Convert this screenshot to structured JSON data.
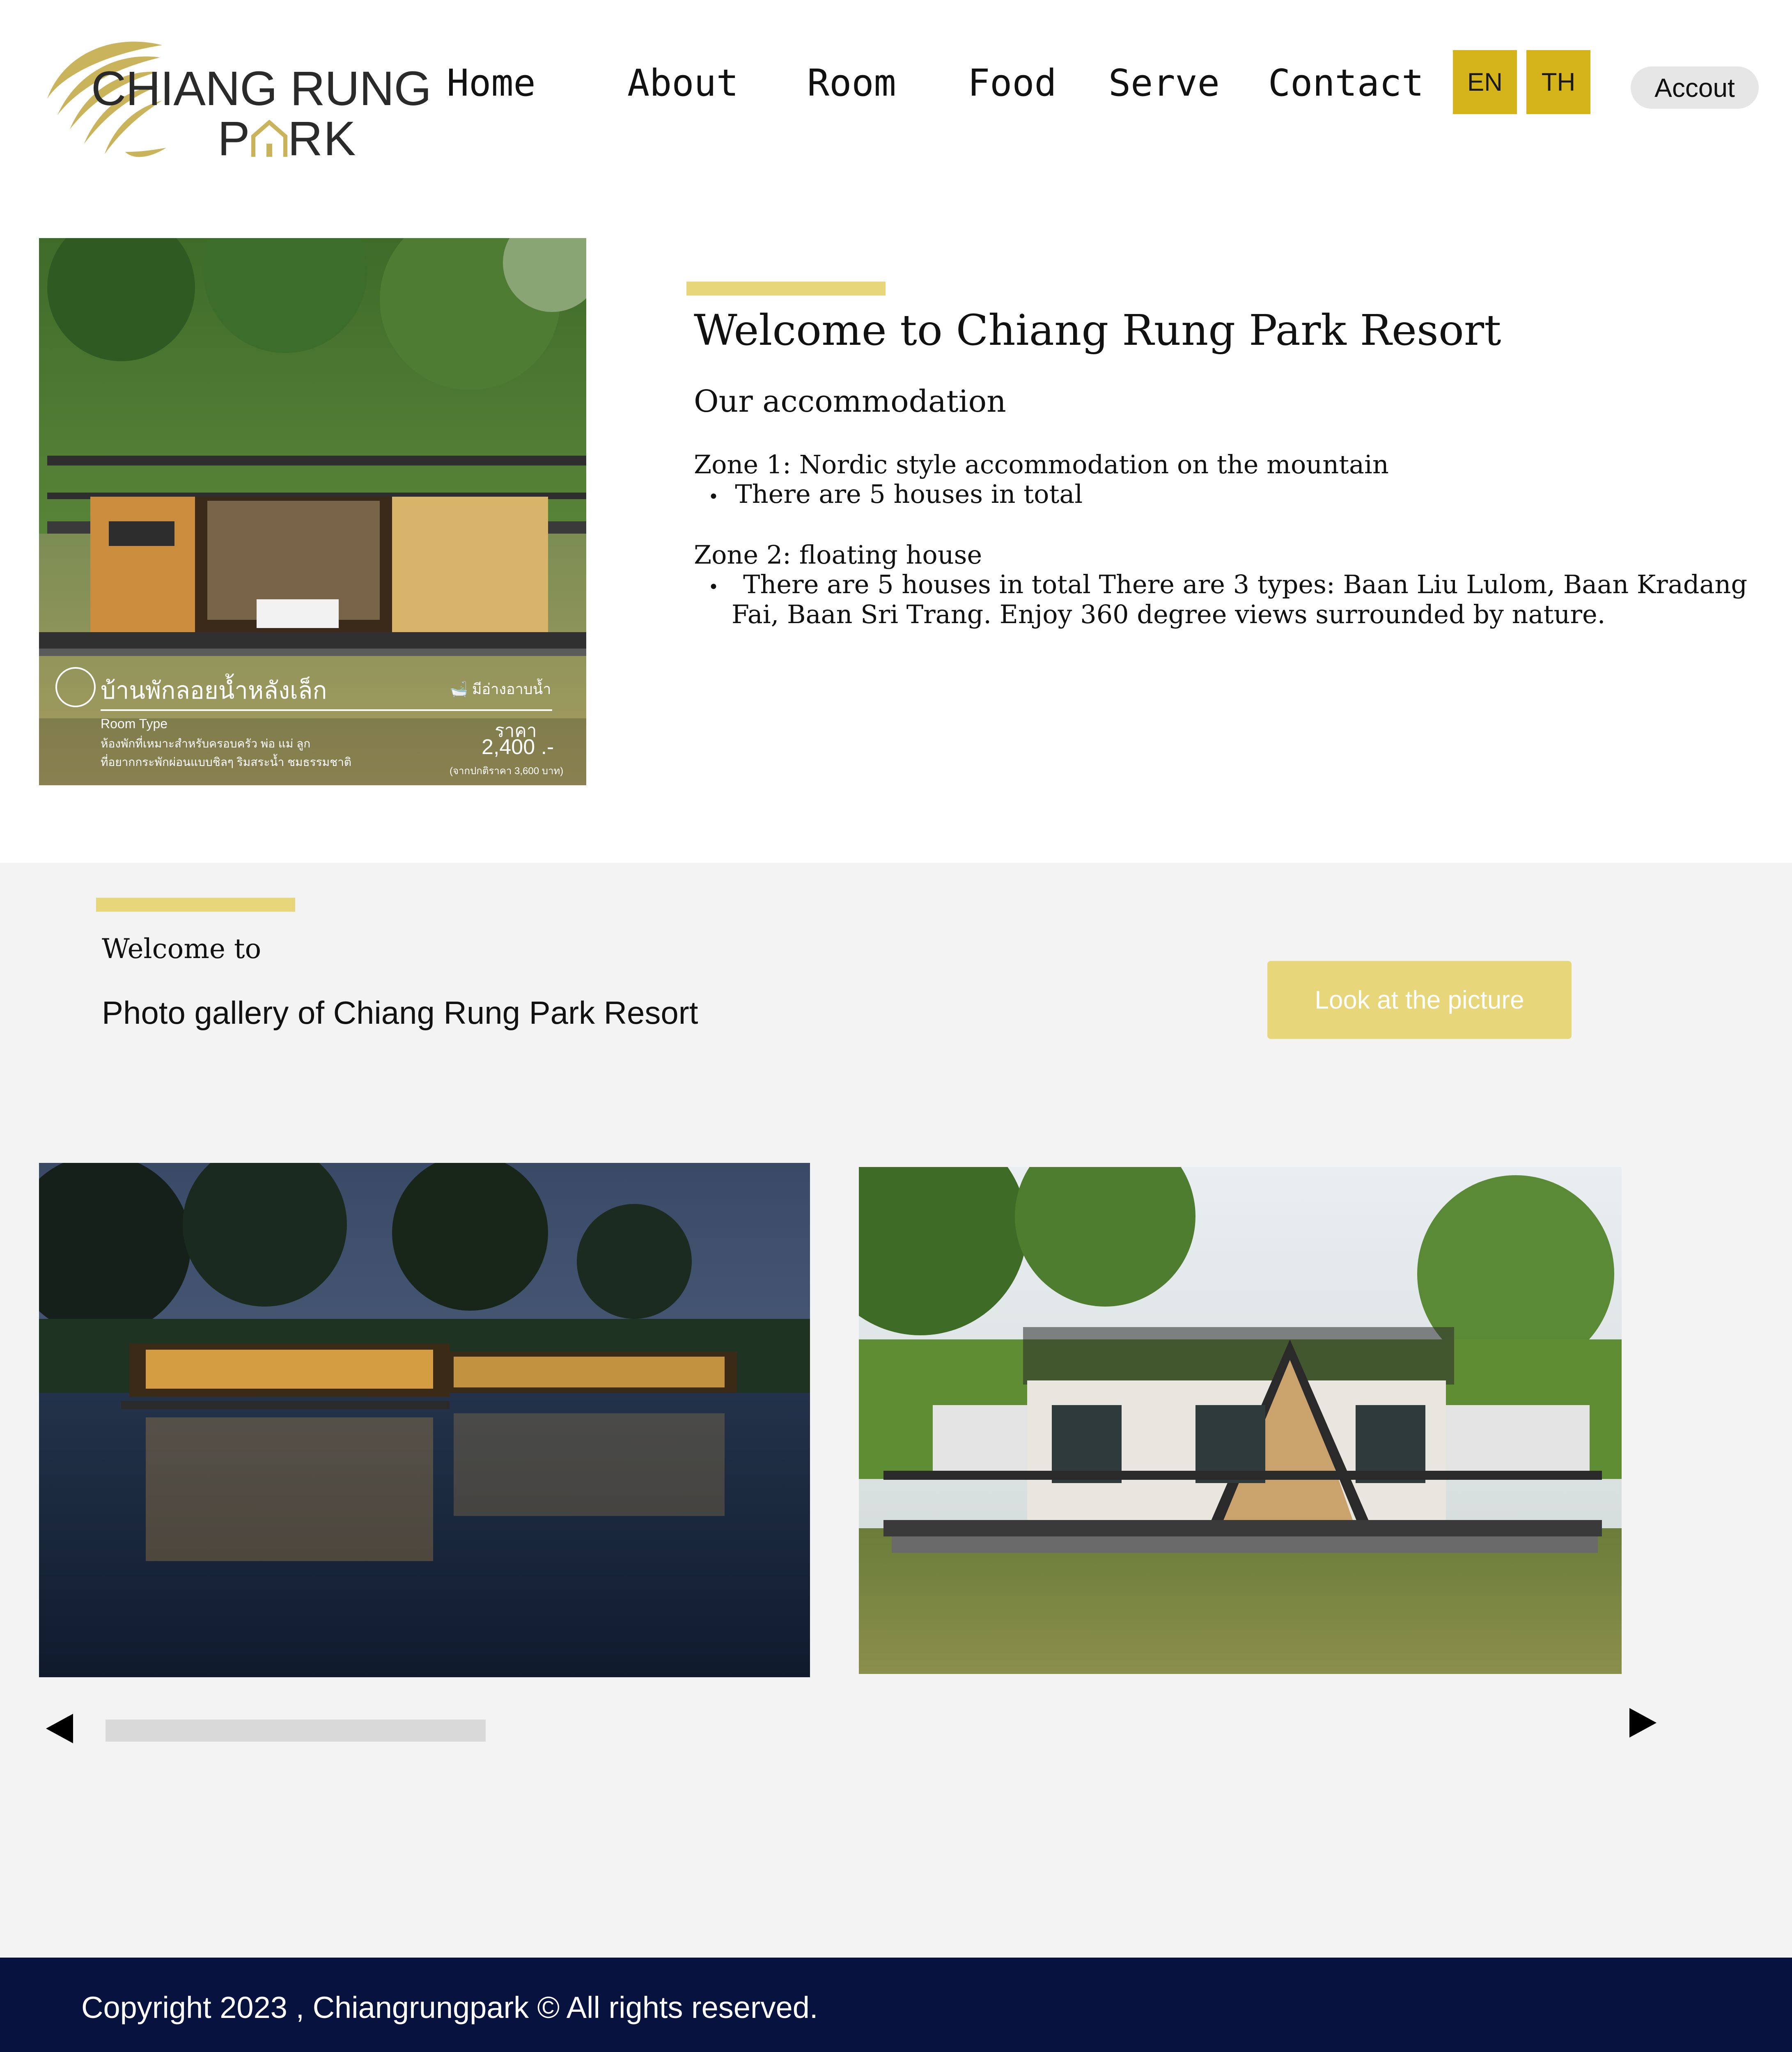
{
  "header": {
    "logo": {
      "line1": "CHIANG RUNG",
      "line2": "P RK",
      "brand_color": "#c9b45c"
    },
    "nav": [
      {
        "label": "Home"
      },
      {
        "label": "About"
      },
      {
        "label": "Room"
      },
      {
        "label": "Food"
      },
      {
        "label": "Serve"
      },
      {
        "label": "Contact"
      }
    ],
    "languages": [
      {
        "label": "EN"
      },
      {
        "label": "TH"
      }
    ],
    "account_label": "Accout"
  },
  "intro": {
    "poster": {
      "title_th": "บ้านพักลอยน้ำหลังเล็ก",
      "tag_th": "มีอ่างอาบน้ำ",
      "room_type_label": "Room Type",
      "desc_line1": "ห้องพักที่เหมาะสำหรับครอบครัว พ่อ แม่ ลูก",
      "desc_line2": "ที่อยากกระพักผ่อนแบบชิลๆ ริมสระน้ำ ชมธรรมชาติ",
      "price_label": "ราคา",
      "price": "2,400 .-",
      "price_note": "(จากปกติราคา 3,600 บาท)"
    },
    "title": "Welcome to Chiang Rung Park Resort",
    "subtitle": "Our accommodation",
    "zone1_title": "Zone 1: Nordic style accommodation on the mountain",
    "zone1_bullet": "There are 5 houses in total",
    "zone2_title": "Zone 2: floating house",
    "zone2_bullet_line1": "There are 5 houses in total There are 3 types: Baan Liu Lulom, Baan Kradang",
    "zone2_bullet_line2": "Fai, Baan Sri Trang. Enjoy 360 degree views surrounded by nature.",
    "bullet_char": "•"
  },
  "gallery": {
    "small_heading": "Welcome to",
    "title": "Photo gallery of Chiang Rung Park Resort",
    "cta_label": "Look at the picture",
    "prev_icon": "◀",
    "next_icon": "▶"
  },
  "footer": {
    "copyright": "Copyright 2023 , Chiangrungpark © All rights reserved."
  },
  "colors": {
    "accent": "#e8d67a",
    "lang_bg": "#d4b418",
    "footer_bg": "#07123f",
    "band_bg": "#f3f3f3"
  }
}
